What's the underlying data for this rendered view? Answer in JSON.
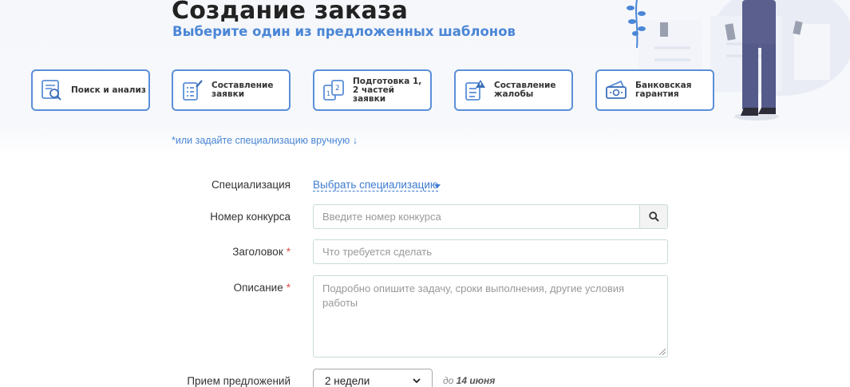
{
  "header": {
    "title": "Создание заказа",
    "subtitle": "Выберите один из предложенных шаблонов"
  },
  "templates": [
    {
      "label": "Поиск и анализ",
      "icon": "search-analysis-icon"
    },
    {
      "label": "Составление заявки",
      "icon": "document-edit-icon"
    },
    {
      "label": "Подготовка 1, 2 частей заявки",
      "icon": "numbered-docs-icon"
    },
    {
      "label": "Составление жалобы",
      "icon": "complaint-warning-icon"
    },
    {
      "label": "Банковская гарантия",
      "icon": "bank-guarantee-icon"
    }
  ],
  "hint": "*или задайте специализацию вручную ↓",
  "form": {
    "specialization": {
      "label": "Специализация",
      "link": "Выбрать специализацию"
    },
    "tender_number": {
      "label": "Номер конкурса",
      "placeholder": "Введите номер конкурса"
    },
    "heading": {
      "label": "Заголовок",
      "required": "*",
      "placeholder": "Что требуется сделать"
    },
    "description": {
      "label": "Описание",
      "required": "*",
      "placeholder": "Подробно опишите задачу, сроки выполнения, другие условия работы"
    },
    "offers": {
      "label": "Прием предложений",
      "value": "2 недели",
      "deadline_prefix": "до",
      "deadline_date": "14 июня"
    }
  },
  "colors": {
    "accent": "#4a86d6",
    "card_border": "#5b8fd8",
    "required": "#e04a4a"
  }
}
